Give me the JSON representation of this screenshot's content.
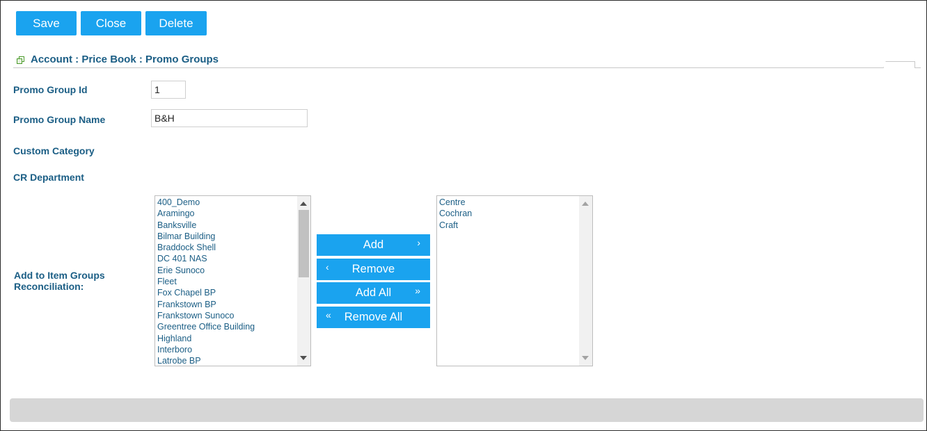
{
  "toolbar": {
    "save_label": "Save",
    "close_label": "Close",
    "delete_label": "Delete"
  },
  "section": {
    "title": "Account : Price Book : Promo Groups"
  },
  "form": {
    "promo_group_id_label": "Promo Group Id",
    "promo_group_id_value": "1",
    "promo_group_name_label": "Promo Group Name",
    "promo_group_name_value": "B&H",
    "custom_category_label": "Custom Category",
    "cr_department_label": "CR Department",
    "add_to_item_groups_label_line1": "Add to Item Groups",
    "add_to_item_groups_label_line2": "Reconciliation:"
  },
  "available_list": {
    "items": [
      "400_Demo",
      "Aramingo",
      "Banksville",
      "Bilmar Building",
      "Braddock Shell",
      "DC 401 NAS",
      "Erie Sunoco",
      "Fleet",
      "Fox Chapel BP",
      "Frankstown BP",
      "Frankstown Sunoco",
      "Greentree Office Building",
      "Highland",
      "Interboro",
      "Latrobe BP"
    ]
  },
  "selected_list": {
    "items": [
      "Centre",
      "Cochran",
      "Craft"
    ]
  },
  "transfer_buttons": {
    "add_label": "Add",
    "remove_label": "Remove",
    "add_all_label": "Add All",
    "remove_all_label": "Remove All",
    "chevron_right": "›",
    "chevron_left": "‹",
    "double_chevron_right": "»",
    "double_chevron_left": "«"
  },
  "colors": {
    "button_blue": "#1aa3ef",
    "label_blue": "#1b5e85",
    "footer_gray": "#d6d6d6",
    "icon_green": "#4a9a2a"
  }
}
